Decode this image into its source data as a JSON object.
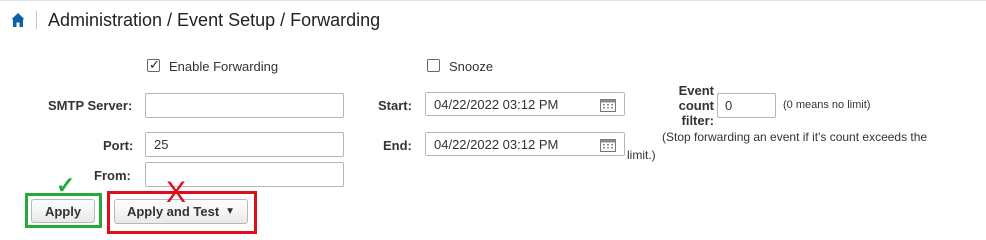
{
  "header": {
    "icon": "home-icon",
    "title": "Administration / Event Setup / Forwarding"
  },
  "form": {
    "enable_forwarding": {
      "label": "Enable Forwarding",
      "checked": true
    },
    "snooze": {
      "label": "Snooze",
      "checked": false
    },
    "smtp_server": {
      "label": "SMTP Server:",
      "value": ""
    },
    "port": {
      "label": "Port:",
      "value": "25"
    },
    "from": {
      "label": "From:",
      "value": ""
    },
    "start": {
      "label": "Start:",
      "value": "04/22/2022 03:12 PM",
      "icon": "calendar-icon"
    },
    "end": {
      "label": "End:",
      "value": "04/22/2022 03:12 PM",
      "icon": "calendar-icon"
    },
    "event_count_filter": {
      "label_line1": "Event",
      "label_line2": "count",
      "label_line3": "filter:",
      "value": "0",
      "hint": "(0 means no limit)"
    },
    "stop_note_line1": "(Stop forwarding an event if it's count exceeds the",
    "stop_note_line2": "limit.)"
  },
  "buttons": {
    "apply": "Apply",
    "apply_and_test": "Apply and Test"
  },
  "annotations": {
    "check_mark": "✓",
    "x_mark": "X",
    "check_color": "#22aa3d",
    "x_color": "#e00d1a"
  }
}
